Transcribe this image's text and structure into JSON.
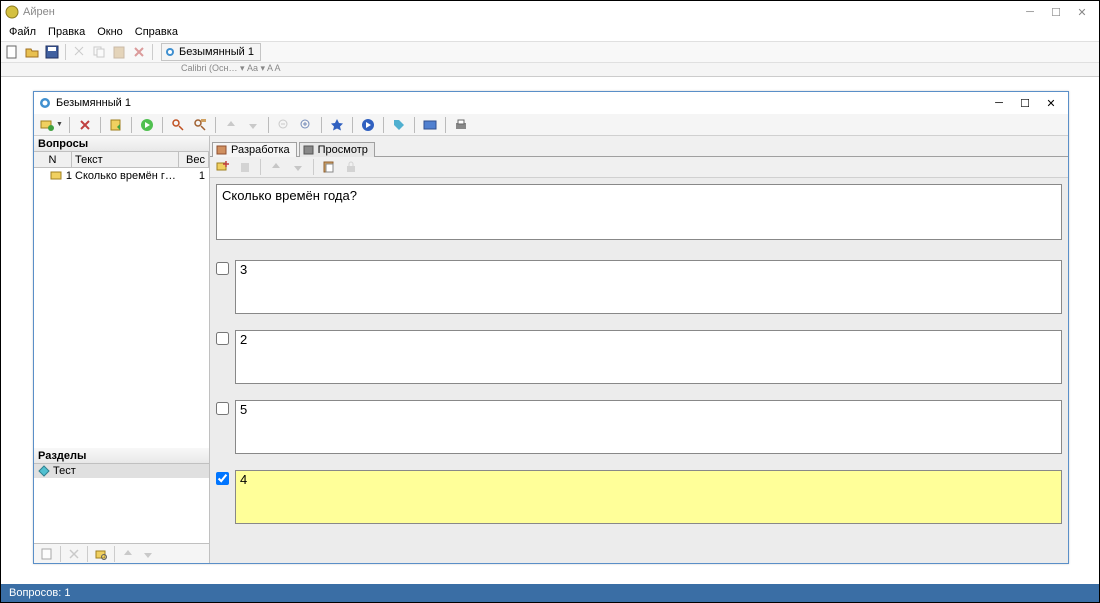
{
  "app": {
    "title": "Айрен"
  },
  "menu": {
    "file": "Файл",
    "edit": "Правка",
    "window": "Окно",
    "help": "Справка"
  },
  "docTab": {
    "label": "Безымянный 1"
  },
  "hiddenToolbar": "Calibri (Осн…   ▾  Aa ▾   A   A                                                                                                     ",
  "editor": {
    "title": "Безымянный 1",
    "leftPanel": {
      "questionsHeader": "Вопросы",
      "cols": {
        "n": "N",
        "text": "Текст",
        "weight": "Вес"
      },
      "rows": [
        {
          "n": "1",
          "text": "Сколько времён г…",
          "weight": "1"
        }
      ],
      "sectionsHeader": "Разделы",
      "sections": [
        {
          "name": "Тест"
        }
      ]
    },
    "tabs": {
      "dev": "Разработка",
      "preview": "Просмотр"
    },
    "question": "Сколько времён года?",
    "answers": [
      {
        "text": "3",
        "correct": false
      },
      {
        "text": "2",
        "correct": false
      },
      {
        "text": "5",
        "correct": false
      },
      {
        "text": "4",
        "correct": true
      }
    ]
  },
  "status": {
    "questions": "Вопросов: 1"
  }
}
